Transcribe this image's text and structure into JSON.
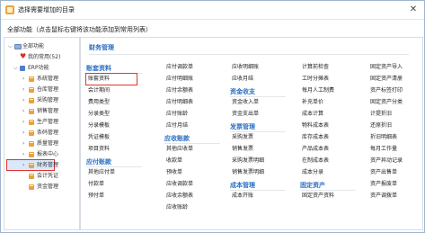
{
  "window": {
    "title": "选择需要增加的目录",
    "close_label": "✕"
  },
  "subtitle": "全部功能（点击鼠标右键将该功能添加到常用列表）",
  "tree": [
    {
      "label": "全部功能",
      "level": 0,
      "toggle": "⌵",
      "icon": "monitor-icon"
    },
    {
      "label": "我的常用(52)",
      "level": 1,
      "toggle": "",
      "icon": "heart-icon"
    },
    {
      "label": "ERP功能",
      "level": 1,
      "toggle": "⌵",
      "icon": "erp-icon"
    },
    {
      "label": "系统管理",
      "level": 2,
      "toggle": "›",
      "icon": "folder-icon"
    },
    {
      "label": "仓库管理",
      "level": 2,
      "toggle": "›",
      "icon": "folder-icon"
    },
    {
      "label": "采购管理",
      "level": 2,
      "toggle": "›",
      "icon": "folder-icon"
    },
    {
      "label": "销售管理",
      "level": 2,
      "toggle": "›",
      "icon": "folder-icon"
    },
    {
      "label": "生产管理",
      "level": 2,
      "toggle": "›",
      "icon": "folder-icon"
    },
    {
      "label": "条码管理",
      "level": 2,
      "toggle": "›",
      "icon": "folder-icon"
    },
    {
      "label": "质量管理",
      "level": 2,
      "toggle": "›",
      "icon": "folder-icon"
    },
    {
      "label": "报表中心",
      "level": 2,
      "toggle": "›",
      "icon": "folder-icon"
    },
    {
      "label": "财务管理",
      "level": 2,
      "toggle": "›",
      "icon": "folder-icon",
      "selected": true
    },
    {
      "label": "会计凭证",
      "level": 2,
      "toggle": "",
      "icon": "folder-icon"
    },
    {
      "label": "资金管理",
      "level": 2,
      "toggle": "",
      "icon": "folder-icon"
    }
  ],
  "main": {
    "header": "财务管理",
    "columns": [
      [
        {
          "type": "section",
          "text": "账套资料"
        },
        {
          "type": "item",
          "text": "账套资料",
          "highlighted": true
        },
        {
          "type": "item",
          "text": "会计期间"
        },
        {
          "type": "item",
          "text": "费用类型"
        },
        {
          "type": "item",
          "text": "分录类型"
        },
        {
          "type": "item",
          "text": "分录模板"
        },
        {
          "type": "item",
          "text": "凭证模板"
        },
        {
          "type": "item",
          "text": "项目资料"
        },
        {
          "type": "section",
          "text": "应付账款"
        },
        {
          "type": "item",
          "text": "其他应付单"
        },
        {
          "type": "item",
          "text": "付款单"
        },
        {
          "type": "item",
          "text": "预付单"
        }
      ],
      [
        {
          "type": "item",
          "text": "应付调款单"
        },
        {
          "type": "item",
          "text": "应付明细账"
        },
        {
          "type": "item",
          "text": "应付余额表"
        },
        {
          "type": "item",
          "text": "应付明细表"
        },
        {
          "type": "item",
          "text": "应付账龄"
        },
        {
          "type": "item",
          "text": "应付月结"
        },
        {
          "type": "section",
          "text": "应收账款"
        },
        {
          "type": "item",
          "text": "其他应收单"
        },
        {
          "type": "item",
          "text": "收款单"
        },
        {
          "type": "item",
          "text": "预收单"
        },
        {
          "type": "item",
          "text": "应收调款单"
        },
        {
          "type": "item",
          "text": "应收余额表"
        },
        {
          "type": "item",
          "text": "应收账龄"
        }
      ],
      [
        {
          "type": "item",
          "text": "应收明细账"
        },
        {
          "type": "item",
          "text": "应收月结"
        },
        {
          "type": "section",
          "text": "资金收支"
        },
        {
          "type": "item",
          "text": "资金收入单"
        },
        {
          "type": "item",
          "text": "资金支出单"
        },
        {
          "type": "section",
          "text": "发票管理"
        },
        {
          "type": "item",
          "text": "采购发票"
        },
        {
          "type": "item",
          "text": "销售发票"
        },
        {
          "type": "item",
          "text": "采购发票明细"
        },
        {
          "type": "item",
          "text": "销售发票明细"
        },
        {
          "type": "section",
          "text": "成本管理"
        },
        {
          "type": "item",
          "text": "成本开账"
        }
      ],
      [
        {
          "type": "item",
          "text": "计算前检查"
        },
        {
          "type": "item",
          "text": "工时分摊表"
        },
        {
          "type": "item",
          "text": "每月人工制费"
        },
        {
          "type": "item",
          "text": "补充单价"
        },
        {
          "type": "item",
          "text": "成本计算"
        },
        {
          "type": "item",
          "text": "物料成本表"
        },
        {
          "type": "item",
          "text": "库存成本表"
        },
        {
          "type": "item",
          "text": "产品成本表"
        },
        {
          "type": "item",
          "text": "在制成本表"
        },
        {
          "type": "item",
          "text": "成本分录"
        },
        {
          "type": "section",
          "text": "固定资产"
        },
        {
          "type": "item",
          "text": "固定资产资料"
        }
      ],
      [
        {
          "type": "item",
          "text": "固定资产导入"
        },
        {
          "type": "item",
          "text": "固定资产清册"
        },
        {
          "type": "item",
          "text": "资产标签打印"
        },
        {
          "type": "item",
          "text": "固定资产分类"
        },
        {
          "type": "item",
          "text": "计提折旧"
        },
        {
          "type": "item",
          "text": "还原折旧"
        },
        {
          "type": "item",
          "text": "折旧明细表"
        },
        {
          "type": "item",
          "text": "每月工作量"
        },
        {
          "type": "item",
          "text": "资产异动记录"
        },
        {
          "type": "item",
          "text": "资产出售单"
        },
        {
          "type": "item",
          "text": "资产报废单"
        },
        {
          "type": "item",
          "text": "资产调拨单"
        }
      ]
    ]
  },
  "colors": {
    "accent": "#2b6fc4",
    "highlight_border": "#e0342f",
    "selection_bg": "#d9e9fb"
  }
}
